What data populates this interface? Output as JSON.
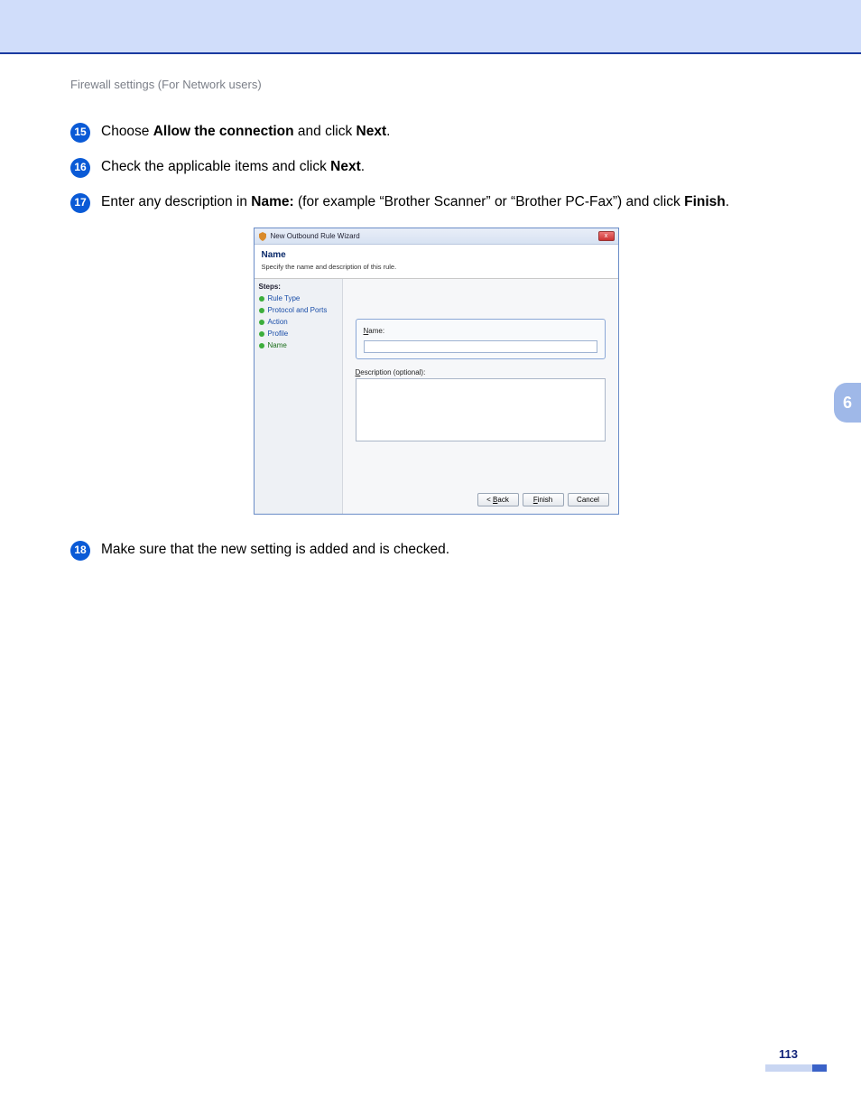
{
  "section": "Firewall settings (For Network users)",
  "chapter": "6",
  "page_number": "113",
  "steps": {
    "s15": {
      "num": "15",
      "pre": "Choose ",
      "b1": "Allow the connection",
      "mid": " and click ",
      "b2": "Next",
      "end": "."
    },
    "s16": {
      "num": "16",
      "pre": "Check the applicable items and click ",
      "b1": "Next",
      "end": "."
    },
    "s17": {
      "num": "17",
      "pre": "Enter any description in ",
      "b1": "Name:",
      "mid": " (for example “Brother Scanner” or “Brother PC-Fax”) and click ",
      "b2": "Finish",
      "end": "."
    },
    "s18": {
      "num": "18",
      "text": "Make sure that the new setting is added and is checked."
    }
  },
  "wizard": {
    "title": "New Outbound Rule Wizard",
    "close": "x",
    "header_title": "Name",
    "header_sub": "Specify the name and description of this rule.",
    "steps_label": "Steps:",
    "side_steps": {
      "a": "Rule Type",
      "b": "Protocol and Ports",
      "c": "Action",
      "d": "Profile",
      "e": "Name"
    },
    "name_label_u": "N",
    "name_label_rest": "ame:",
    "name_value": "",
    "desc_label_u": "D",
    "desc_label_rest": "escription (optional):",
    "desc_value": "",
    "btn_back_pre": "< ",
    "btn_back_u": "B",
    "btn_back_rest": "ack",
    "btn_finish_u": "F",
    "btn_finish_rest": "inish",
    "btn_cancel": "Cancel"
  }
}
